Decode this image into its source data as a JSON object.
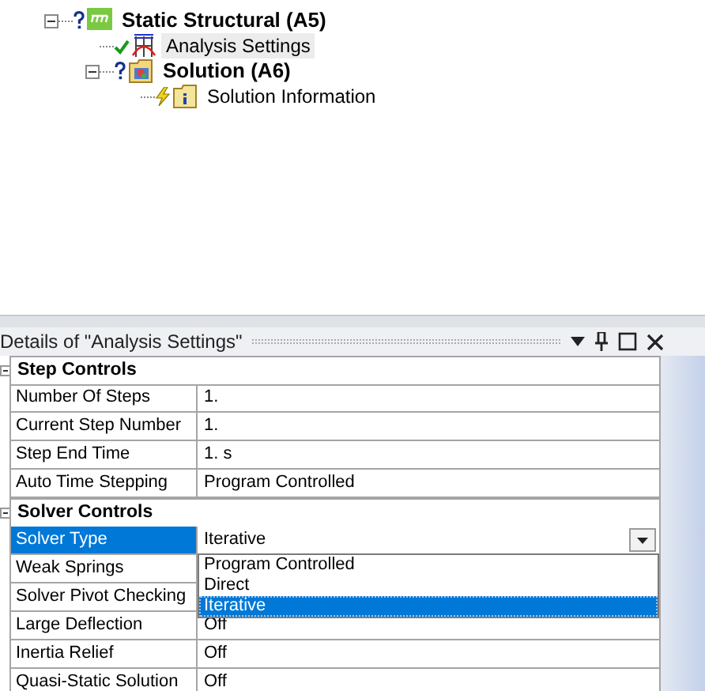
{
  "tree": [
    {
      "label": "Static Structural (A5)",
      "kind": "environment",
      "done": false,
      "pending": false,
      "selected": false,
      "expanded": true,
      "children": [
        {
          "label": "Analysis Settings",
          "kind": "settings",
          "done": true,
          "pending": false,
          "selected": true
        },
        {
          "label": "Solution (A6)",
          "kind": "solution",
          "done": false,
          "pending": false,
          "selected": false,
          "expanded": true,
          "children": [
            {
              "label": "Solution Information",
              "kind": "info",
              "done": false,
              "pending": true,
              "selected": false
            }
          ]
        }
      ]
    }
  ],
  "details": {
    "title": "Details of \"Analysis Settings\"",
    "groups": [
      {
        "name": "Step Controls",
        "expanded": true,
        "rows": [
          {
            "label": "Number Of Steps",
            "value": "1.",
            "selected": false
          },
          {
            "label": "Current Step Number",
            "value": "1.",
            "selected": false
          },
          {
            "label": "Step End Time",
            "value": "1. s",
            "selected": false
          },
          {
            "label": "Auto Time Stepping",
            "value": "Program Controlled",
            "selected": false
          }
        ]
      },
      {
        "name": "Solver Controls",
        "expanded": true,
        "rows": [
          {
            "label": "Solver Type",
            "value": "Iterative",
            "selected": true,
            "kind": "dropdown",
            "open": true,
            "options": [
              {
                "label": "Program Controlled",
                "selected": false
              },
              {
                "label": "Direct",
                "selected": false
              },
              {
                "label": "Iterative",
                "selected": true
              }
            ]
          },
          {
            "label": "Weak Springs",
            "selected": false
          },
          {
            "label": "Solver Pivot Checking",
            "selected": false
          },
          {
            "label": "Large Deflection",
            "value": "Off",
            "selected": false
          },
          {
            "label": "Inertia Relief",
            "value": "Off",
            "selected": false
          },
          {
            "label": "Quasi-Static Solution",
            "value": "Off",
            "selected": false
          }
        ]
      }
    ]
  }
}
